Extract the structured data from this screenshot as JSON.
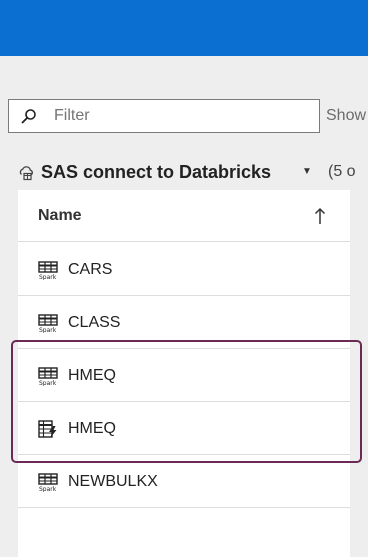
{
  "filter": {
    "placeholder": "Filter"
  },
  "show_text": "Show",
  "library": {
    "name": "SAS connect to Databricks",
    "count_text": "(5 o"
  },
  "table": {
    "column_header": "Name",
    "sort_direction": "ascending",
    "rows": [
      {
        "name": "CARS",
        "icon": "spark-table-icon"
      },
      {
        "name": "CLASS",
        "icon": "spark-table-icon"
      },
      {
        "name": "HMEQ",
        "icon": "spark-table-icon"
      },
      {
        "name": "HMEQ",
        "icon": "loaded-table-icon"
      },
      {
        "name": "NEWBULKX",
        "icon": "spark-table-icon"
      }
    ]
  },
  "colors": {
    "header_blue": "#0a6fd1",
    "highlight": "#6b2a55"
  }
}
